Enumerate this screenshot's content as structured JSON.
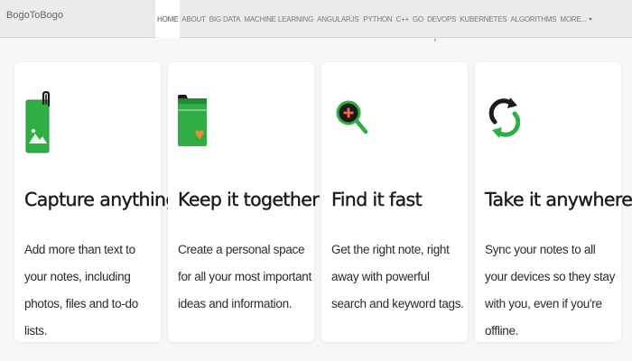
{
  "navbar": {
    "brand": "BogoToBogo",
    "items": [
      {
        "label": "HOME",
        "active": true
      },
      {
        "label": "ABOUT"
      },
      {
        "label": "BIG DATA"
      },
      {
        "label": "MACHINE LEARNING"
      },
      {
        "label": "ANGULARJS"
      },
      {
        "label": "PYTHON"
      },
      {
        "label": "C++"
      },
      {
        "label": "GO"
      },
      {
        "label": "DEVOPS"
      },
      {
        "label": "KUBERNETES"
      },
      {
        "label": "ALGORITHMS"
      },
      {
        "label": "MORE..."
      }
    ]
  },
  "features": [
    {
      "icon": "photo-clip-icon",
      "title": "Capture anything",
      "description": "Add more than text to your notes, including photos, files and to-do lists."
    },
    {
      "icon": "folder-heart-icon",
      "title": "Keep it together",
      "description": "Create a personal space for all your most important ideas and information."
    },
    {
      "icon": "magnifier-icon",
      "title": "Find it fast",
      "description": "Get the right note, right away with powerful search and keyword tags."
    },
    {
      "icon": "sync-icon",
      "title": "Take it anywhere",
      "description": "Sync your notes to all your devices so they stay with you, even if you're offline."
    }
  ],
  "colors": {
    "accent_green": "#2db34a",
    "dark_green": "#1f7a2f",
    "navbar_bg": "#ebebeb",
    "card_bg": "#ffffff",
    "page_bg": "#f7f7f7"
  }
}
